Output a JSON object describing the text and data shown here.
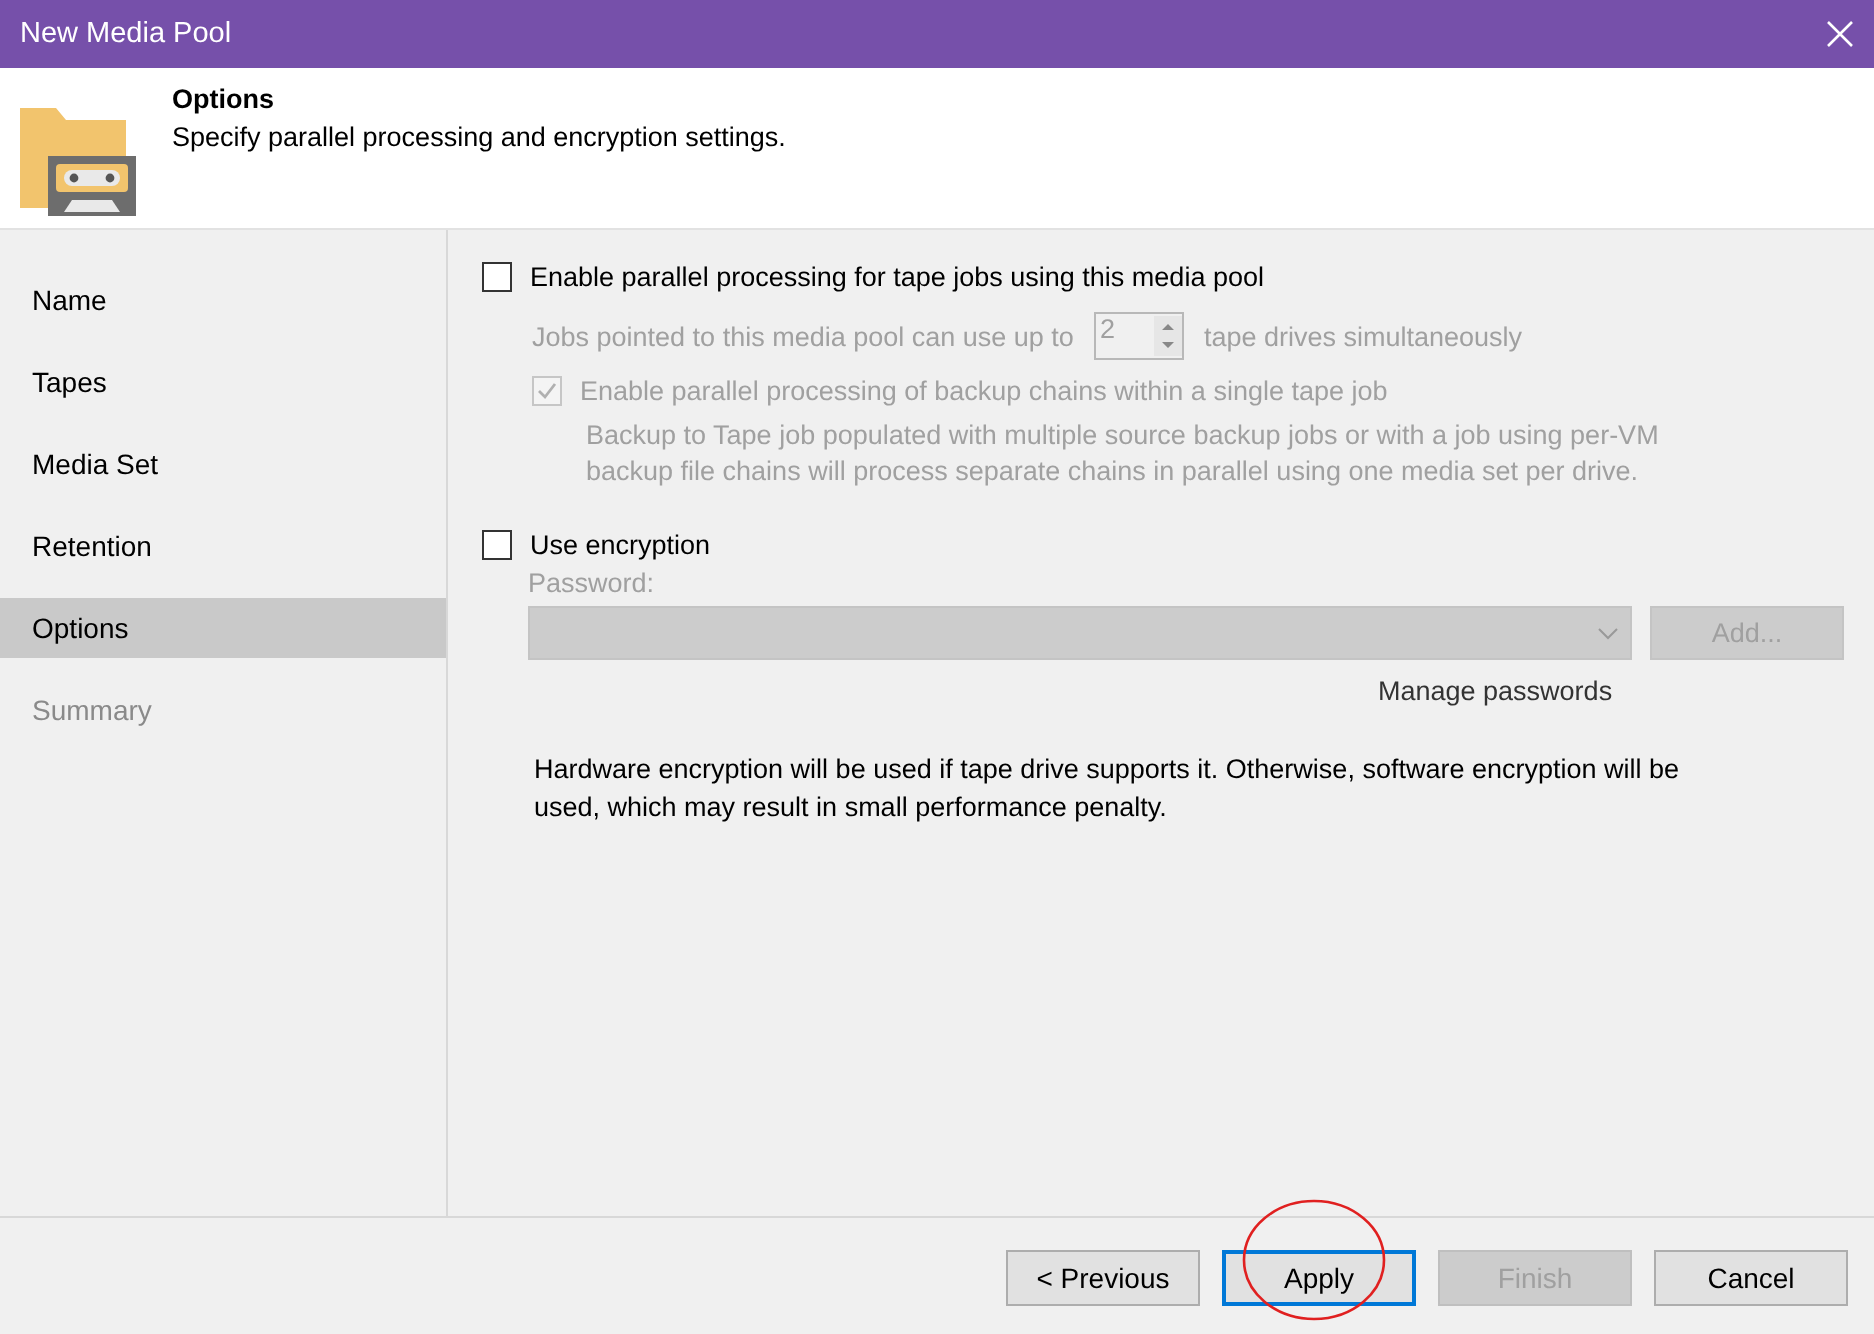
{
  "window": {
    "title": "New Media Pool"
  },
  "header": {
    "title": "Options",
    "subtitle": "Specify parallel processing and encryption settings."
  },
  "steps": [
    {
      "label": "Name",
      "selected": false,
      "disabled": false
    },
    {
      "label": "Tapes",
      "selected": false,
      "disabled": false
    },
    {
      "label": "Media Set",
      "selected": false,
      "disabled": false
    },
    {
      "label": "Retention",
      "selected": false,
      "disabled": false
    },
    {
      "label": "Options",
      "selected": true,
      "disabled": false
    },
    {
      "label": "Summary",
      "selected": false,
      "disabled": true
    }
  ],
  "parallel": {
    "label": "Enable parallel processing for tape jobs using this media pool",
    "checked": false,
    "drives_prefix": "Jobs pointed to this media pool can use up to",
    "drives_value": "2",
    "drives_suffix": "tape drives simultaneously",
    "disabled": true,
    "chains": {
      "label": "Enable parallel processing of backup chains within a single tape job",
      "checked": true,
      "disabled": true
    },
    "chains_note": "Backup to Tape job populated with multiple source backup jobs or with a job using per-VM backup file chains will process separate chains in parallel using one media set per drive."
  },
  "encryption": {
    "label": "Use encryption",
    "checked": false,
    "disabled": true,
    "password_label": "Password:",
    "add_button": "Add...",
    "manage_link": "Manage passwords"
  },
  "note": "Hardware encryption will be used if tape drive supports it. Otherwise, software encryption will be used, which may result in small performance penalty.",
  "buttons": [
    {
      "label": "< Previous",
      "kind": "normal",
      "circled": false
    },
    {
      "label": "Apply",
      "kind": "focused",
      "circled": true
    },
    {
      "label": "Finish",
      "kind": "disabled",
      "circled": false
    },
    {
      "label": "Cancel",
      "kind": "normal",
      "circled": false
    }
  ]
}
